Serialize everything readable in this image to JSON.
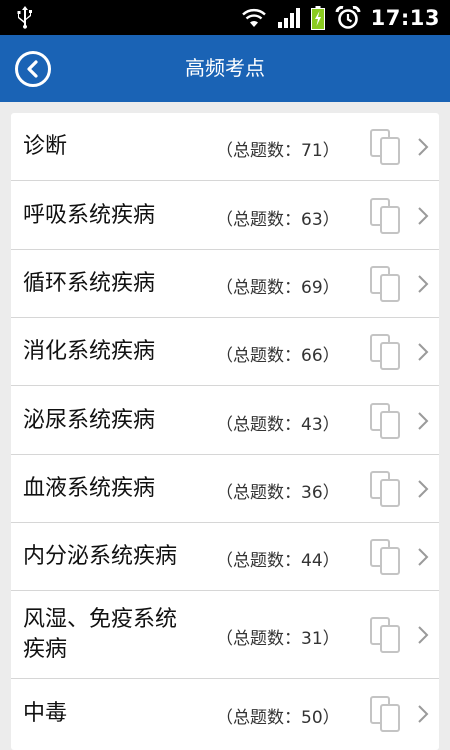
{
  "status_bar": {
    "time": "17:13",
    "icons": [
      "usb-icon",
      "wifi-icon",
      "signal-icon",
      "battery-charging-icon",
      "alarm-icon"
    ]
  },
  "header": {
    "title": "高频考点",
    "back_icon": "back-circle-icon",
    "color": "#1a63b5"
  },
  "list": {
    "items": [
      {
        "name": "诊断",
        "count": "（总题数：71）"
      },
      {
        "name": "呼吸系统疾病",
        "count": "（总题数：63）"
      },
      {
        "name": "循环系统疾病",
        "count": "（总题数：69）"
      },
      {
        "name": "消化系统疾病",
        "count": "（总题数：66）"
      },
      {
        "name": "泌尿系统疾病",
        "count": "（总题数：43）"
      },
      {
        "name": "血液系统疾病",
        "count": "（总题数：36）"
      },
      {
        "name": "内分泌系统疾病",
        "count": "（总题数：44）"
      },
      {
        "name": "风湿、免疫系统疾病",
        "name_lines": [
          "风湿、免疫系统",
          "疾病"
        ],
        "count": "（总题数：31）"
      },
      {
        "name": "中毒",
        "count": "（总题数：50）"
      }
    ],
    "item_icons": [
      "document-copy-icon",
      "chevron-right-icon"
    ]
  }
}
